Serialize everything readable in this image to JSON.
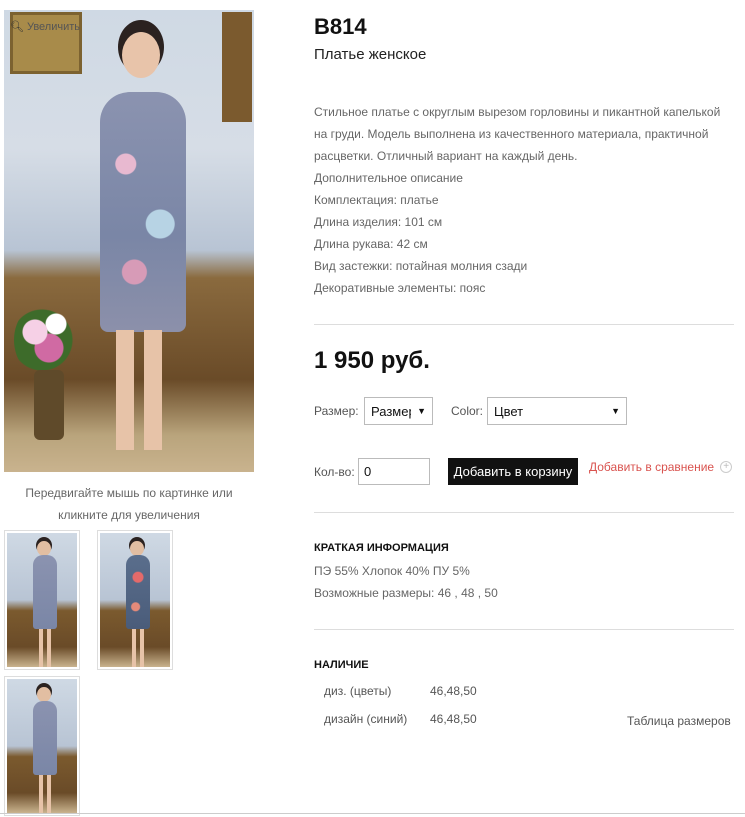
{
  "gallery": {
    "zoom_label": "Увеличить",
    "zoom_icon": "search-icon",
    "hint": "Передвигайте мышь по картинке или кликните для увеличения"
  },
  "product": {
    "sku": "B814",
    "subtitle": "Платье женское",
    "description": [
      "Стильное платье с округлым вырезом горловины и пикантной капелькой",
      "на груди. Модель выполнена из качественного материала, практичной",
      "расцветки. Отличный вариант на каждый день.",
      "Дополнительное описание",
      "Комплектация: платье",
      "Длина изделия: 101 см",
      "Длина рукава: 42 см",
      "Вид застежки: потайная молния сзади",
      "Декоративные элементы: пояс"
    ],
    "price": "1 950 руб."
  },
  "options": {
    "size_label": "Размер:",
    "size_value": "Размер",
    "color_label": "Color:",
    "color_value": "Цвет",
    "qty_label": "Кол-во:",
    "qty_value": "0",
    "add_to_cart": "Добавить в корзину",
    "add_to_compare": "Добавить в сравнение"
  },
  "brief": {
    "title": "КРАТКАЯ ИНФОРМАЦИЯ",
    "composition": "ПЭ 55% Хлопок 40% ПУ 5%",
    "sizes": "Возможные размеры: 46 , 48 , 50"
  },
  "availability": {
    "title": "НАЛИЧИЕ",
    "rows": [
      {
        "name": "диз. (цветы)",
        "sizes": "46,48,50"
      },
      {
        "name": "дизайн (синий)",
        "sizes": "46,48,50"
      }
    ],
    "size_table_link": "Таблица размеров"
  },
  "colors": {
    "accent_red": "#d9534f",
    "button_bg": "#111111"
  }
}
